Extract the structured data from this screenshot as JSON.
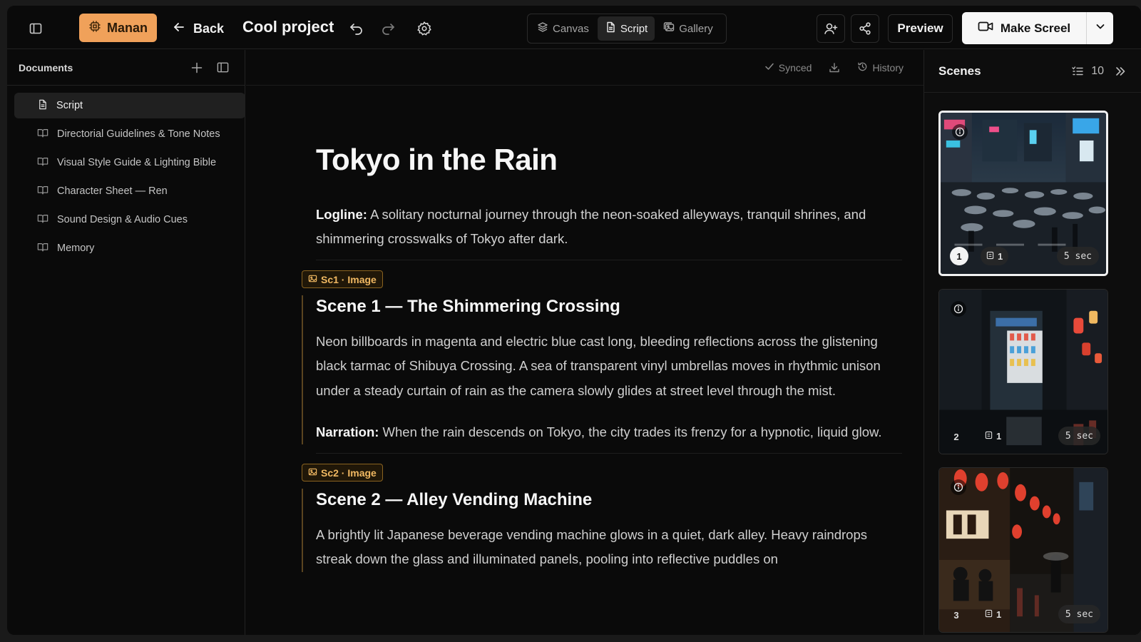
{
  "topbar": {
    "workspace": "Manan",
    "back_label": "Back",
    "project_title": "Cool project",
    "modes": [
      {
        "label": "Canvas",
        "icon": "layers-icon",
        "active": false
      },
      {
        "label": "Script",
        "icon": "file-icon",
        "active": true
      },
      {
        "label": "Gallery",
        "icon": "gallery-icon",
        "active": false
      }
    ],
    "preview_label": "Preview",
    "make_label": "Make Screel",
    "accent": "#f0a15a"
  },
  "sidebar": {
    "title": "Documents",
    "items": [
      {
        "label": "Script",
        "icon": "file-icon",
        "active": true
      },
      {
        "label": "Directorial Guidelines & Tone Notes",
        "icon": "book-icon"
      },
      {
        "label": "Visual Style Guide & Lighting Bible",
        "icon": "book-icon"
      },
      {
        "label": "Character Sheet — Ren",
        "icon": "book-icon"
      },
      {
        "label": "Sound Design & Audio Cues",
        "icon": "book-icon"
      },
      {
        "label": "Memory",
        "icon": "book-icon"
      }
    ]
  },
  "toolbar": {
    "synced": "Synced",
    "history": "History"
  },
  "document": {
    "title": "Tokyo in the Rain",
    "logline_label": "Logline:",
    "logline": "A solitary nocturnal journey through the neon-soaked alleyways, tranquil shrines, and shimmering crosswalks of Tokyo after dark.",
    "scenes": [
      {
        "tag": "Sc1 · Image",
        "heading": "Scene 1 — The Shimmering Crossing",
        "body": "Neon billboards in magenta and electric blue cast long, bleeding reflections across the glistening black tarmac of Shibuya Crossing. A sea of transparent vinyl umbrellas moves in rhythmic unison under a steady curtain of rain as the camera slowly glides at street level through the mist.",
        "narration_label": "Narration:",
        "narration": "When the rain descends on Tokyo, the city trades its frenzy for a hypnotic, liquid glow."
      },
      {
        "tag": "Sc2 · Image",
        "heading": "Scene 2 — Alley Vending Machine",
        "body": "A brightly lit Japanese beverage vending machine glows in a quiet, dark alley. Heavy raindrops streak down the glass and illuminated panels, pooling into reflective puddles on"
      }
    ]
  },
  "scenes_panel": {
    "title": "Scenes",
    "count": "10",
    "cards": [
      {
        "number": "1",
        "shots": "1",
        "duration": "5 sec",
        "selected": true
      },
      {
        "number": "2",
        "shots": "1",
        "duration": "5 sec",
        "selected": false
      },
      {
        "number": "3",
        "shots": "1",
        "duration": "5 sec",
        "selected": false
      }
    ]
  }
}
